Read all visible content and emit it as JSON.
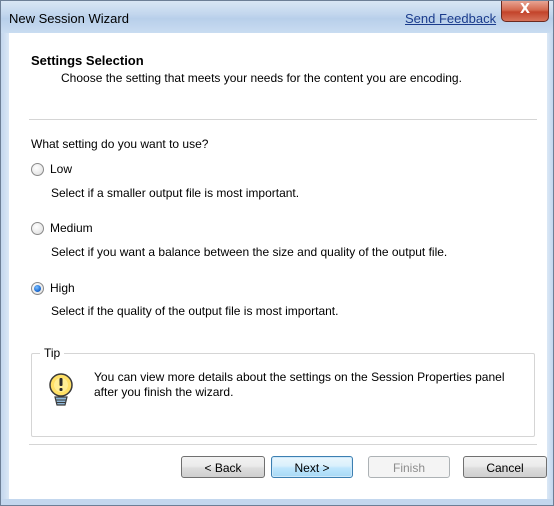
{
  "window": {
    "title": "New Session Wizard",
    "feedback_link": "Send Feedback",
    "close_symbol": "X"
  },
  "header": {
    "title": "Settings Selection",
    "description": "Choose the setting that meets your needs for the content you are encoding."
  },
  "question": "What setting do you want to use?",
  "options": [
    {
      "label": "Low",
      "description": "Select if a smaller output file is most important.",
      "selected": false
    },
    {
      "label": "Medium",
      "description": "Select if you want a balance between the size and quality of the output file.",
      "selected": false
    },
    {
      "label": "High",
      "description": "Select if the quality of the output file is most important.",
      "selected": true
    }
  ],
  "tip": {
    "label": "Tip",
    "icon": "lightbulb-icon",
    "text": "You can view more details about the settings on the Session Properties panel after you finish the wizard."
  },
  "buttons": {
    "back": "< Back",
    "next": "Next >",
    "finish": "Finish",
    "cancel": "Cancel"
  },
  "colors": {
    "link": "#1a3b8c",
    "close_button": "#c3432a",
    "default_button_border": "#3c7fb1"
  }
}
